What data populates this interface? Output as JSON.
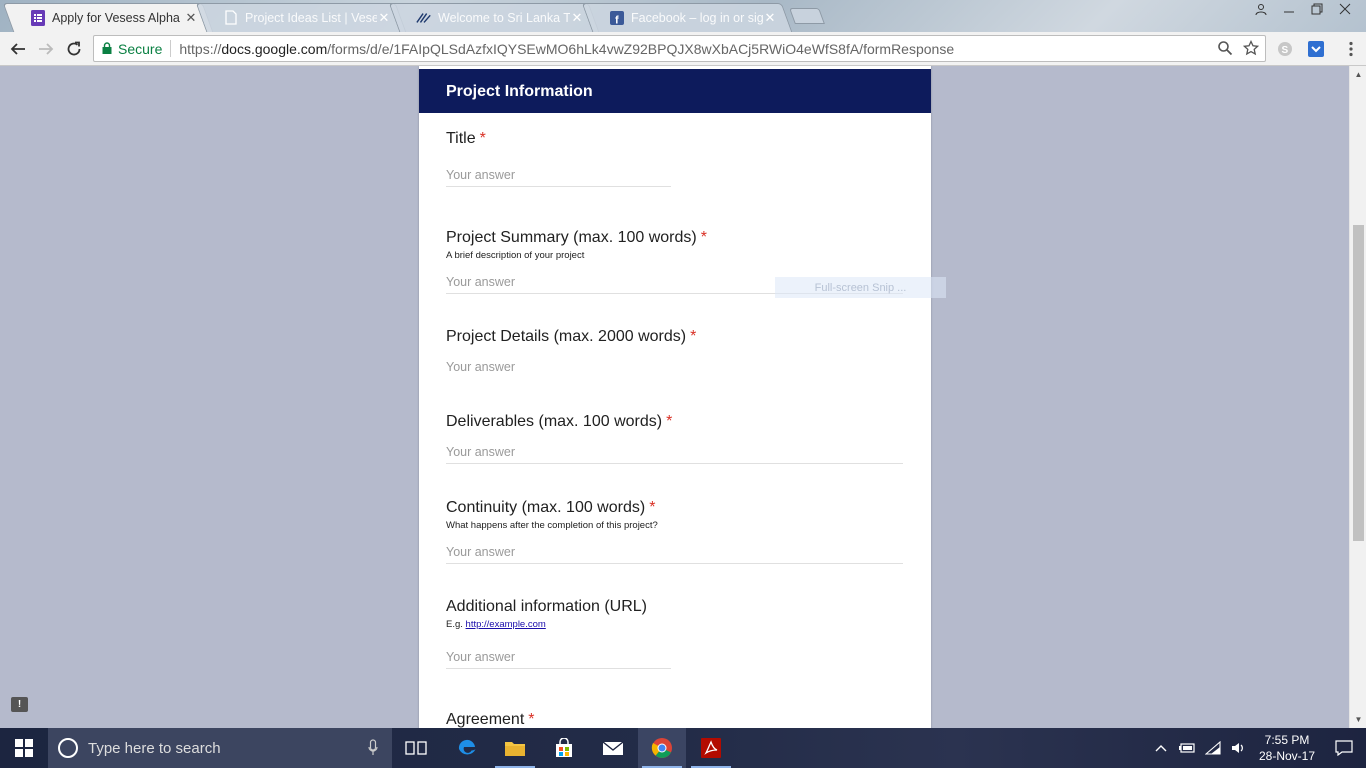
{
  "browser": {
    "tabs": [
      {
        "title": "Apply for Vesess Alpha",
        "icon": "google-forms-icon",
        "active": true
      },
      {
        "title": "Project Ideas List | Vesess",
        "icon": "document-icon",
        "active": false
      },
      {
        "title": "Welcome to Sri Lanka Te",
        "icon": "site-logo-icon",
        "active": false
      },
      {
        "title": "Facebook – log in or sign",
        "icon": "facebook-icon",
        "active": false
      }
    ],
    "close_glyph": "✕",
    "secure_label": "Secure",
    "url_scheme": "https://",
    "url_host": "docs.google.com",
    "url_path": "/forms/d/e/1FAIpQLSdAzfxIQYSEwMO6hLk4vwZ92BPQJX8wXbACj5RWiO4eWfS8fA/formResponse"
  },
  "form": {
    "section_title": "Project Information",
    "placeholder": "Your answer",
    "required_mark": "*",
    "questions": [
      {
        "label": "Title",
        "help": ""
      },
      {
        "label": "Project Summary (max. 100 words)",
        "help": "A brief description of your project"
      },
      {
        "label": "Project Details (max. 2000 words)",
        "help": ""
      },
      {
        "label": "Deliverables (max. 100 words)",
        "help": ""
      },
      {
        "label": "Continuity (max. 100 words)",
        "help": "What happens after the completion of this project?"
      },
      {
        "label": "Additional information (URL)",
        "help_prefix": "E.g. ",
        "help_link": "http://example.com"
      },
      {
        "label": "Agreement",
        "help": ""
      }
    ]
  },
  "overlay": {
    "snip_label": "Full-screen Snip ..."
  },
  "feedback_glyph": "!",
  "taskbar": {
    "search_placeholder": "Type here to search",
    "time": "7:55 PM",
    "date": "28-Nov-17"
  },
  "colors": {
    "form_header": "#0d1b5c",
    "page_background": "#b5bacc",
    "required": "#d93025",
    "secure": "#0b8043"
  }
}
